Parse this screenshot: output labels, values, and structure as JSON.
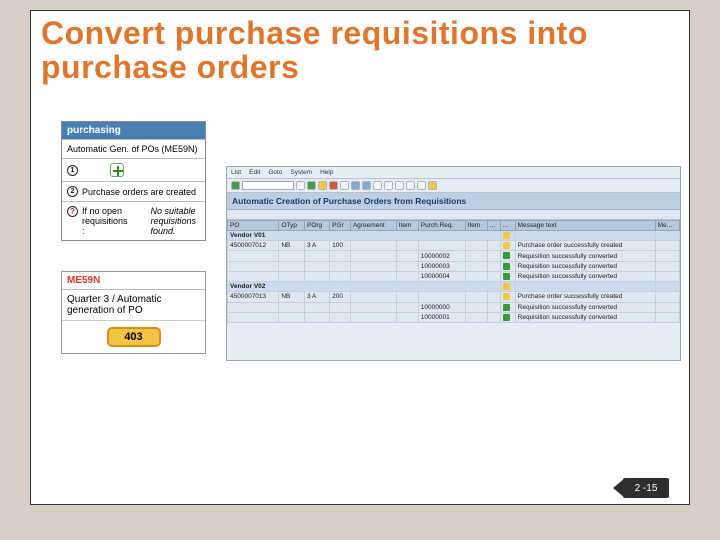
{
  "title": "Convert purchase requisitions into purchase orders",
  "panel1": {
    "heading": "purchasing",
    "sub": "Automatic Gen. of POs (ME59N)",
    "row2": "Purchase orders are created",
    "row3a": "If no open requisitions :",
    "row3b": "No suitable requisitions found."
  },
  "panel2": {
    "code": "ME59N",
    "desc": "Quarter 3 / Automatic generation of PO",
    "badge": "403"
  },
  "sap": {
    "menu": [
      "List",
      "Edit",
      "Goto",
      "System",
      "Help"
    ],
    "title": "Automatic Creation of Purchase Orders from Requisitions",
    "cols": [
      "PO",
      "OTyp",
      "POrg",
      "PGr",
      "Agreement",
      "Item",
      "Purch.Req.",
      "Item",
      "...",
      "...",
      "Message text",
      "Me..."
    ],
    "vendor1": "Vendor V01",
    "vendor2": "Vendor V02",
    "rows1": [
      {
        "po": "4500007012",
        "otyp": "NB",
        "porg": "3 A",
        "pgr": "100",
        "req": "",
        "msg": "Purchase order successfully created",
        "ic": "y"
      },
      {
        "po": "",
        "otyp": "",
        "porg": "",
        "pgr": "",
        "req": "10000002",
        "msg": "Requisition successfully converted",
        "ic": "g"
      },
      {
        "po": "",
        "otyp": "",
        "porg": "",
        "pgr": "",
        "req": "10000003",
        "msg": "Requisition successfully converted",
        "ic": "g"
      },
      {
        "po": "",
        "otyp": "",
        "porg": "",
        "pgr": "",
        "req": "10000004",
        "msg": "Requisition successfully converted",
        "ic": "g"
      }
    ],
    "rows2": [
      {
        "po": "4500007013",
        "otyp": "NB",
        "porg": "3 A",
        "pgr": "200",
        "req": "",
        "msg": "Purchase order successfully created",
        "ic": "y"
      },
      {
        "po": "",
        "otyp": "",
        "porg": "",
        "pgr": "",
        "req": "10000000",
        "msg": "Requisition successfully converted",
        "ic": "g"
      },
      {
        "po": "",
        "otyp": "",
        "porg": "",
        "pgr": "",
        "req": "10000001",
        "msg": "Requisition successfully converted",
        "ic": "g"
      }
    ]
  },
  "slidenum": "2 -15"
}
